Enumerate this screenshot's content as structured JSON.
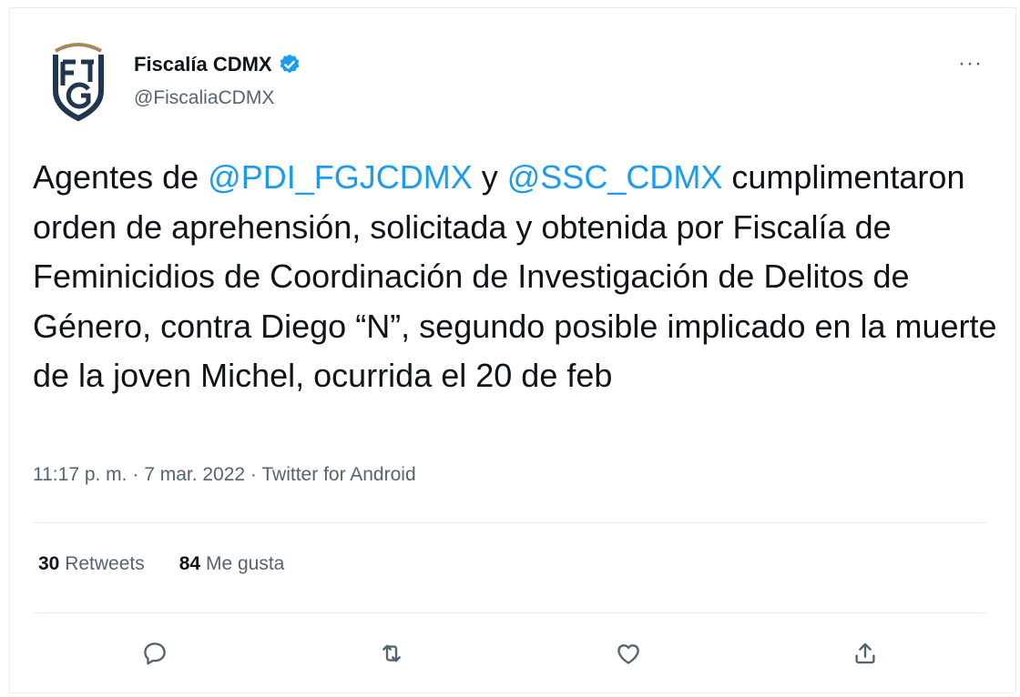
{
  "author": {
    "name": "Fiscalía CDMX",
    "handle": "@FiscaliaCDMX",
    "avatar_icon": "fgj-logo-icon",
    "verified_icon": "verified-badge-icon"
  },
  "more_icon": "more-options-icon",
  "more_label": "···",
  "tweet": {
    "part1": "Agentes de ",
    "mention1": "@PDI_FGJCDMX",
    "part2": " y  ",
    "mention2": "@SSC_CDMX",
    "part3": " cumplimentaron orden de aprehensión, solicitada y obtenida por Fiscalía de Feminicidios de Coordinación de Investigación de Delitos de Género, contra Diego “N”, segundo posible implicado en la muerte de la joven Michel, ocurrida el 20 de feb"
  },
  "meta": {
    "time": "11:17 p. m.",
    "sep1": " · ",
    "date": "7 mar. 2022",
    "sep2": " · ",
    "source": "Twitter for Android"
  },
  "stats": {
    "retweets_count": "30",
    "retweets_label": "Retweets",
    "likes_count": "84",
    "likes_label": "Me gusta"
  },
  "actions": {
    "reply_icon": "reply-icon",
    "retweet_icon": "retweet-icon",
    "like_icon": "like-icon",
    "share_icon": "share-icon"
  },
  "colors": {
    "mention": "#1d9bf0",
    "secondary_text": "#536471",
    "logo_navy": "#1f3550",
    "logo_gold": "#a9855a"
  }
}
